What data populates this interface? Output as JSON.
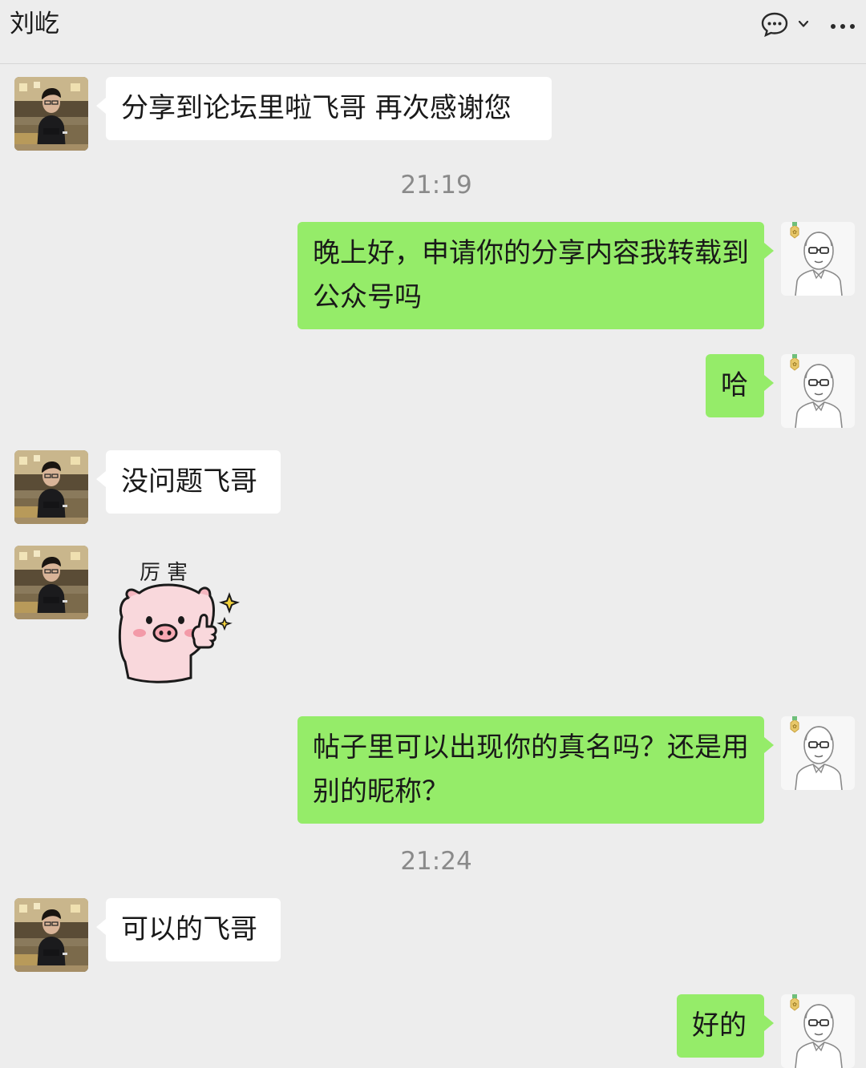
{
  "header": {
    "title": "刘屹",
    "chat_icon": "chat-bubble-icon",
    "dropdown_icon": "chevron-down-icon",
    "more_icon": "more-icon"
  },
  "messages": [
    {
      "side": "in",
      "text": "分享到论坛里啦飞哥 再次感谢您"
    },
    {
      "time": "21:19"
    },
    {
      "side": "out",
      "text": "晚上好，申请你的分享内容我转载到公众号吗"
    },
    {
      "side": "out",
      "text": "哈"
    },
    {
      "side": "in",
      "text": "没问题飞哥"
    },
    {
      "side": "in",
      "sticker": "pig-thumbs-up-sticker",
      "text": "厉害"
    },
    {
      "side": "out",
      "text": "帖子里可以出现你的真名吗？还是用别的昵称？"
    },
    {
      "time": "21:24"
    },
    {
      "side": "in",
      "text": "可以的飞哥"
    },
    {
      "side": "out",
      "text": "好的"
    }
  ],
  "colors": {
    "background": "#ededed",
    "incoming_bubble": "#ffffff",
    "outgoing_bubble": "#95ec69",
    "timestamp": "#8a8a8a"
  }
}
